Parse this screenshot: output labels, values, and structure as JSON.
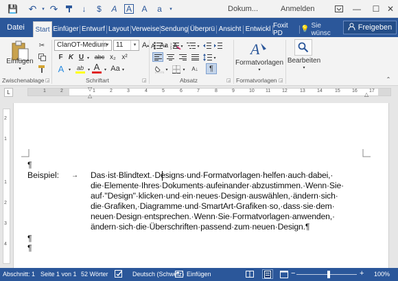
{
  "titlebar": {
    "title": "Dokum...",
    "signin": "Anmelden",
    "qat_icons": [
      "save-icon",
      "undo-icon",
      "redo-icon",
      "format-painter-icon",
      "arrow-down-icon",
      "dollar-icon",
      "font-a-icon",
      "framed-a-icon",
      "clear-format-icon",
      "superscript-a-icon"
    ],
    "save_glyph": "💾",
    "undo_glyph": "↶",
    "redo_glyph": "↷",
    "qat_glyphs": [
      "↓",
      "$",
      "A",
      "A",
      "A",
      "a"
    ],
    "minimize": "—",
    "maximize": "☐",
    "close": "✕",
    "restore": "⧉"
  },
  "tabs": {
    "file": "Datei",
    "start": "Start",
    "einfuegen": "Einfüger",
    "entwurf": "Entwurf",
    "layout": "Layout",
    "verweise": "Verweise",
    "sendung": "Sendung",
    "ueberpruefen": "Überprü",
    "ansicht": "Ansicht",
    "entwickler": "Entwickl",
    "foxit": "Foxit PD",
    "tell_me": "Sie wünsc",
    "share": "Freigeben"
  },
  "ribbon": {
    "paste_label": "Einfügen",
    "clipboard_group": "Zwischenablage",
    "font_name": "ClanOT-Medium",
    "font_size": "11",
    "font_group": "Schriftart",
    "paragraph_group": "Absatz",
    "styles_label": "Formatvorlagen",
    "styles_group": "Formatvorlagen",
    "edit_label": "Bearbeiten",
    "bold": "F",
    "italic": "K",
    "underline": "U",
    "strike": "abc",
    "subscript": "x₂",
    "superscript": "x²",
    "grow_font": "A",
    "shrink_font": "A",
    "case": "Aa",
    "text_effects": "A",
    "highlight": "ab",
    "font_color": "A",
    "pilcrow": "¶",
    "sort": "A↓"
  },
  "ruler": {
    "numbers": [
      "1",
      "2",
      "1",
      "1",
      "2",
      "3",
      "4",
      "5",
      "6",
      "7",
      "8",
      "9",
      "10",
      "11",
      "12",
      "13",
      "14",
      "15",
      "16",
      "17"
    ],
    "vnumbers": [
      "2",
      "1",
      "1",
      "2",
      "3",
      "4"
    ],
    "tab_selector": "L"
  },
  "document": {
    "pilcrow_top": "¶",
    "label": "Beispiel:",
    "tab_arrow": "→",
    "lines": [
      "Das·ist·Blindtext.·Designs·und·Formatvorlagen·helfen·auch·dabei,·",
      "die·Elemente·Ihres·Dokuments·aufeinander·abzustimmen.·Wenn·Sie·",
      "auf·\"Design\"·klicken·und·ein·neues·Design·auswählen,·ändern·sich·",
      "die·Grafiken,·Diagramme·und·SmartArt-Grafiken·so,·dass·sie·dem·",
      "neuen·Design·entsprechen.·Wenn·Sie·Formatvorlagen·anwenden,·",
      "ändern·sich·die·Überschriften·passend·zum·neuen·Design.¶"
    ],
    "pilcrow_1": "¶",
    "pilcrow_2": "¶"
  },
  "statusbar": {
    "section": "Abschnitt: 1",
    "page": "Seite 1 von 1",
    "words": "52 Wörter",
    "language": "Deutsch (Schweiz)",
    "mode": "Einfügen",
    "zoom": "100%",
    "zoom_minus": "−",
    "zoom_plus": "+",
    "zoom_level": 1.0
  },
  "colors": {
    "accent": "#2b579a",
    "font_color_bar": "#e02020",
    "highlight_bar": "#ffff00"
  }
}
